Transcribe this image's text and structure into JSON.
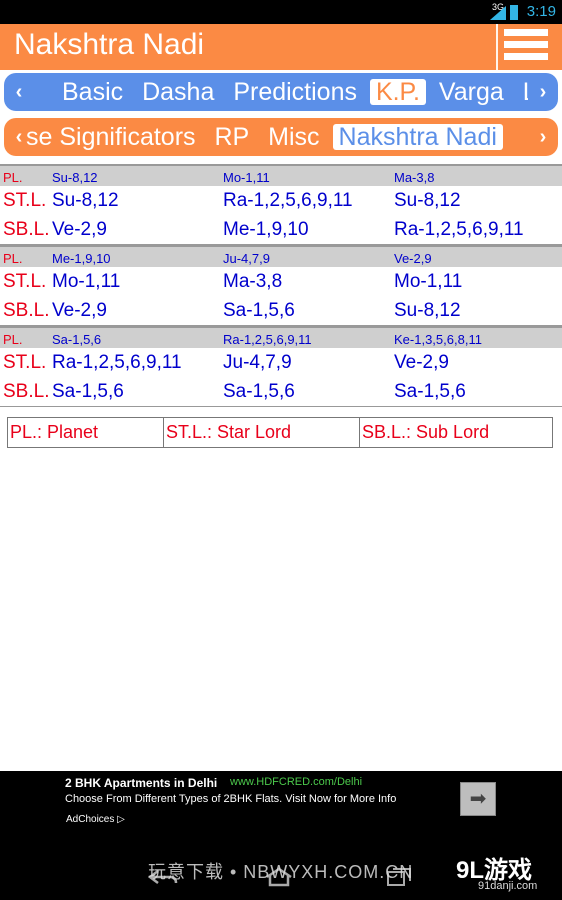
{
  "status_bar": {
    "network": "3G",
    "time": "3:19"
  },
  "app": {
    "title": "Nakshtra Nadi"
  },
  "tabs_top": {
    "left_arrow": "‹",
    "right_arrow": "›",
    "items": [
      "Basic",
      "Dasha",
      "Predictions",
      "K.P.",
      "Varga",
      "L"
    ],
    "selected": "K.P."
  },
  "tabs_sub": {
    "left_arrow": "‹",
    "right_arrow": "›",
    "items": [
      "se Significators",
      "RP",
      "Misc",
      "Nakshtra Nadi"
    ],
    "selected": "Nakshtra Nadi"
  },
  "nadi": {
    "groups": [
      {
        "pl": {
          "label": "PL.",
          "c1": "Su-8,12",
          "c2": "Mo-1,11",
          "c3": "Ma-3,8"
        },
        "stl": {
          "label": "ST.L.",
          "c1": "Su-8,12",
          "c2": "Ra-1,2,5,6,9,11",
          "c3": "Su-8,12"
        },
        "sbl": {
          "label": "SB.L.",
          "c1": "Ve-2,9",
          "c2": "Me-1,9,10",
          "c3": "Ra-1,2,5,6,9,11"
        }
      },
      {
        "pl": {
          "label": "PL.",
          "c1": "Me-1,9,10",
          "c2": "Ju-4,7,9",
          "c3": "Ve-2,9"
        },
        "stl": {
          "label": "ST.L.",
          "c1": "Mo-1,11",
          "c2": "Ma-3,8",
          "c3": "Mo-1,11"
        },
        "sbl": {
          "label": "SB.L.",
          "c1": "Ve-2,9",
          "c2": "Sa-1,5,6",
          "c3": "Su-8,12"
        }
      },
      {
        "pl": {
          "label": "PL.",
          "c1": "Sa-1,5,6",
          "c2": "Ra-1,2,5,6,9,11",
          "c3": "Ke-1,3,5,6,8,11"
        },
        "stl": {
          "label": "ST.L.",
          "c1": "Ra-1,2,5,6,9,11",
          "c2": "Ju-4,7,9",
          "c3": "Ve-2,9"
        },
        "sbl": {
          "label": "SB.L.",
          "c1": "Sa-1,5,6",
          "c2": "Sa-1,5,6",
          "c3": "Sa-1,5,6"
        }
      }
    ]
  },
  "legend": [
    "PL.: Planet",
    "ST.L.: Star Lord",
    "SB.L.: Sub Lord"
  ],
  "ad": {
    "headline": "2 BHK Apartments in Delhi",
    "url": "www.HDFCRED.com/Delhi",
    "description": "Choose From Different Types of 2BHK Flats. Visit Now for More Info",
    "adchoices": "AdChoices ▷",
    "go_icon": "arrow-right-icon"
  },
  "watermark": {
    "text": "玩意下载 • NBWYXH.COM.CN",
    "logo": "9L游戏",
    "site": "91danji.com"
  },
  "colors": {
    "accent_orange": "#fb8a44",
    "accent_blue": "#5b8fe8",
    "label_red": "#e8001a",
    "value_blue": "#0000cc",
    "pl_row_bg": "#cfcfcf"
  }
}
